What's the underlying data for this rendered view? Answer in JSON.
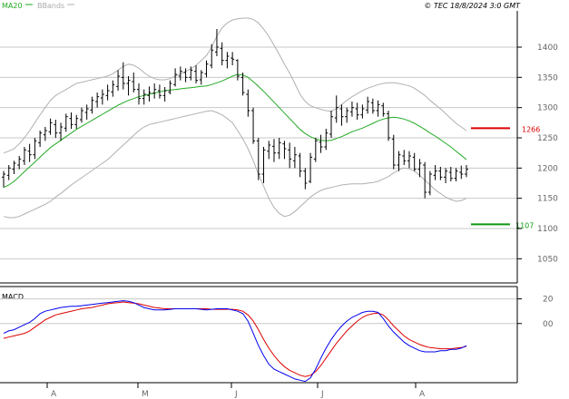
{
  "header": {
    "legend_ma": "MA20",
    "legend_bb": "BBands",
    "copyright": "© TEC 18/8/2024 3:0 GMT"
  },
  "macd_panel": {
    "label": "MACD"
  },
  "colors": {
    "bars": "#000000",
    "ma": "#22aa22",
    "bbands": "#b0b0b0",
    "macd": "#0000ee",
    "signal": "#dd0000",
    "resistance": "#dd0000",
    "support": "#119911",
    "grid": "#c8c8c8"
  },
  "chart_data": [
    {
      "type": "ohlc",
      "title": "",
      "y_ticks": [
        "1400",
        "1350",
        "1300",
        "1250",
        "1200",
        "1150",
        "1100",
        "1050"
      ],
      "x_tick_labels": [
        "A",
        "M",
        "J",
        "J",
        "A"
      ],
      "resistance": {
        "value": 1266,
        "label": "1266"
      },
      "support": {
        "value": 1107,
        "label": "1107"
      },
      "ylim": [
        1010,
        1460
      ],
      "bars": [
        [
          1185,
          1195,
          1168,
          1190
        ],
        [
          1188,
          1205,
          1180,
          1200
        ],
        [
          1198,
          1212,
          1190,
          1208
        ],
        [
          1205,
          1220,
          1198,
          1215
        ],
        [
          1212,
          1235,
          1205,
          1230
        ],
        [
          1228,
          1240,
          1210,
          1222
        ],
        [
          1222,
          1250,
          1215,
          1245
        ],
        [
          1242,
          1262,
          1235,
          1258
        ],
        [
          1255,
          1268,
          1245,
          1262
        ],
        [
          1260,
          1282,
          1255,
          1275
        ],
        [
          1272,
          1280,
          1250,
          1258
        ],
        [
          1258,
          1275,
          1245,
          1268
        ],
        [
          1266,
          1290,
          1260,
          1285
        ],
        [
          1282,
          1292,
          1265,
          1272
        ],
        [
          1272,
          1288,
          1265,
          1282
        ],
        [
          1280,
          1300,
          1275,
          1295
        ],
        [
          1292,
          1305,
          1280,
          1298
        ],
        [
          1296,
          1318,
          1290,
          1312
        ],
        [
          1310,
          1325,
          1300,
          1318
        ],
        [
          1316,
          1330,
          1305,
          1322
        ],
        [
          1320,
          1338,
          1312,
          1328
        ],
        [
          1326,
          1345,
          1318,
          1338
        ],
        [
          1335,
          1362,
          1328,
          1352
        ],
        [
          1350,
          1375,
          1330,
          1340
        ],
        [
          1340,
          1352,
          1320,
          1345
        ],
        [
          1343,
          1358,
          1325,
          1330
        ],
        [
          1330,
          1340,
          1305,
          1315
        ],
        [
          1315,
          1330,
          1305,
          1322
        ],
        [
          1320,
          1335,
          1310,
          1325
        ],
        [
          1324,
          1340,
          1315,
          1330
        ],
        [
          1328,
          1338,
          1315,
          1320
        ],
        [
          1320,
          1334,
          1310,
          1328
        ],
        [
          1326,
          1345,
          1322,
          1340
        ],
        [
          1338,
          1365,
          1335,
          1355
        ],
        [
          1352,
          1368,
          1345,
          1360
        ],
        [
          1358,
          1365,
          1342,
          1350
        ],
        [
          1350,
          1368,
          1345,
          1362
        ],
        [
          1360,
          1370,
          1340,
          1345
        ],
        [
          1346,
          1362,
          1338,
          1358
        ],
        [
          1356,
          1378,
          1350,
          1372
        ],
        [
          1370,
          1405,
          1365,
          1395
        ],
        [
          1392,
          1430,
          1385,
          1400
        ],
        [
          1398,
          1408,
          1370,
          1378
        ],
        [
          1378,
          1392,
          1365,
          1385
        ],
        [
          1382,
          1392,
          1370,
          1380
        ],
        [
          1378,
          1380,
          1345,
          1352
        ],
        [
          1350,
          1358,
          1320,
          1325
        ],
        [
          1322,
          1330,
          1285,
          1295
        ],
        [
          1295,
          1300,
          1240,
          1245
        ],
        [
          1245,
          1250,
          1180,
          1190
        ],
        [
          1190,
          1235,
          1175,
          1230
        ],
        [
          1228,
          1245,
          1215,
          1238
        ],
        [
          1236,
          1248,
          1210,
          1225
        ],
        [
          1225,
          1250,
          1215,
          1242
        ],
        [
          1240,
          1245,
          1215,
          1232
        ],
        [
          1230,
          1242,
          1200,
          1215
        ],
        [
          1212,
          1235,
          1200,
          1222
        ],
        [
          1220,
          1225,
          1185,
          1195
        ],
        [
          1195,
          1200,
          1165,
          1175
        ],
        [
          1178,
          1225,
          1175,
          1218
        ],
        [
          1215,
          1250,
          1210,
          1245
        ],
        [
          1243,
          1255,
          1225,
          1235
        ],
        [
          1235,
          1265,
          1230,
          1258
        ],
        [
          1256,
          1295,
          1250,
          1285
        ],
        [
          1283,
          1320,
          1275,
          1300
        ],
        [
          1298,
          1305,
          1270,
          1285
        ],
        [
          1285,
          1300,
          1275,
          1295
        ],
        [
          1293,
          1310,
          1285,
          1300
        ],
        [
          1298,
          1308,
          1280,
          1288
        ],
        [
          1288,
          1305,
          1282,
          1298
        ],
        [
          1296,
          1318,
          1290,
          1310
        ],
        [
          1308,
          1315,
          1290,
          1295
        ],
        [
          1295,
          1312,
          1285,
          1305
        ],
        [
          1303,
          1308,
          1285,
          1290
        ],
        [
          1290,
          1295,
          1245,
          1250
        ],
        [
          1248,
          1255,
          1198,
          1205
        ],
        [
          1205,
          1228,
          1195,
          1222
        ],
        [
          1220,
          1230,
          1205,
          1212
        ],
        [
          1212,
          1228,
          1200,
          1220
        ],
        [
          1218,
          1225,
          1195,
          1198
        ],
        [
          1198,
          1215,
          1185,
          1208
        ],
        [
          1205,
          1210,
          1150,
          1160
        ],
        [
          1160,
          1195,
          1155,
          1190
        ],
        [
          1188,
          1205,
          1180,
          1195
        ],
        [
          1195,
          1202,
          1180,
          1185
        ],
        [
          1185,
          1200,
          1175,
          1195
        ],
        [
          1193,
          1202,
          1178,
          1183
        ],
        [
          1183,
          1200,
          1178,
          1195
        ],
        [
          1193,
          1204,
          1182,
          1190
        ],
        [
          1190,
          1205,
          1185,
          1198
        ]
      ],
      "ma20": [
        1168,
        1172,
        1178,
        1186,
        1194,
        1202,
        1210,
        1218,
        1226,
        1234,
        1240,
        1246,
        1252,
        1258,
        1264,
        1269,
        1274,
        1279,
        1284,
        1289,
        1294,
        1299,
        1304,
        1308,
        1312,
        1315,
        1318,
        1320,
        1322,
        1324,
        1326,
        1328,
        1329,
        1330,
        1331,
        1332,
        1333,
        1334,
        1335,
        1336,
        1338,
        1341,
        1344,
        1348,
        1352,
        1355,
        1354,
        1350,
        1343,
        1335,
        1327,
        1318,
        1309,
        1300,
        1291,
        1282,
        1273,
        1264,
        1257,
        1252,
        1248,
        1246,
        1245,
        1246,
        1249,
        1252,
        1256,
        1260,
        1263,
        1266,
        1270,
        1274,
        1278,
        1281,
        1283,
        1284,
        1283,
        1281,
        1278,
        1274,
        1269,
        1264,
        1258,
        1253,
        1247,
        1241,
        1235,
        1228,
        1221,
        1214
      ],
      "bb_upper": [
        1225,
        1228,
        1232,
        1240,
        1250,
        1262,
        1275,
        1288,
        1300,
        1312,
        1320,
        1325,
        1330,
        1335,
        1340,
        1342,
        1344,
        1346,
        1348,
        1350,
        1352,
        1356,
        1362,
        1368,
        1372,
        1370,
        1365,
        1358,
        1352,
        1348,
        1346,
        1346,
        1348,
        1352,
        1356,
        1360,
        1364,
        1370,
        1378,
        1386,
        1400,
        1418,
        1432,
        1440,
        1445,
        1447,
        1448,
        1448,
        1446,
        1440,
        1430,
        1418,
        1403,
        1388,
        1372,
        1357,
        1340,
        1322,
        1310,
        1303,
        1300,
        1297,
        1295,
        1294,
        1298,
        1305,
        1312,
        1318,
        1323,
        1328,
        1332,
        1335,
        1338,
        1340,
        1341,
        1341,
        1340,
        1338,
        1336,
        1332,
        1326,
        1320,
        1312,
        1305,
        1298,
        1290,
        1282,
        1274,
        1268,
        1262
      ],
      "bb_lower": [
        1120,
        1118,
        1118,
        1120,
        1124,
        1128,
        1132,
        1136,
        1140,
        1145,
        1152,
        1158,
        1165,
        1172,
        1178,
        1184,
        1190,
        1196,
        1202,
        1208,
        1214,
        1222,
        1230,
        1238,
        1246,
        1254,
        1262,
        1268,
        1272,
        1274,
        1276,
        1278,
        1280,
        1282,
        1284,
        1286,
        1288,
        1290,
        1292,
        1294,
        1295,
        1292,
        1288,
        1282,
        1275,
        1262,
        1248,
        1232,
        1212,
        1190,
        1170,
        1150,
        1135,
        1125,
        1120,
        1122,
        1128,
        1136,
        1144,
        1152,
        1158,
        1163,
        1166,
        1168,
        1170,
        1172,
        1173,
        1174,
        1174,
        1174,
        1175,
        1176,
        1178,
        1182,
        1186,
        1192,
        1197,
        1200,
        1199,
        1195,
        1188,
        1180,
        1172,
        1164,
        1158,
        1152,
        1148,
        1145,
        1146,
        1150
      ]
    },
    {
      "type": "line",
      "title": "MACD",
      "y_ticks": [
        "20",
        "00"
      ],
      "ylim": [
        -48,
        30
      ],
      "series": [
        {
          "name": "",
          "values": [
            -8,
            -6,
            -5,
            -3,
            -1,
            1,
            4,
            8,
            10,
            11,
            12,
            13,
            13.5,
            14,
            14,
            14.5,
            15,
            15.5,
            16,
            16.5,
            17,
            17.5,
            18,
            18.5,
            18,
            17,
            15,
            13,
            12,
            11,
            11,
            11,
            11.5,
            12,
            12,
            12,
            12,
            12,
            11.5,
            11,
            11.5,
            12,
            12,
            12,
            11,
            10,
            8,
            2,
            -8,
            -18,
            -26,
            -33,
            -37,
            -39,
            -41,
            -43,
            -45,
            -46,
            -47,
            -44,
            -37,
            -28,
            -20,
            -13,
            -7,
            -2,
            2,
            5,
            7,
            9,
            10,
            10,
            9,
            4,
            -2,
            -7,
            -11,
            -15,
            -18,
            -20,
            -22,
            -23,
            -23,
            -23,
            -22,
            -22,
            -21,
            -21,
            -20,
            -18
          ]
        },
        {
          "name": "",
          "values": [
            -12,
            -11,
            -10,
            -9,
            -8,
            -6,
            -3,
            0,
            3,
            5,
            7,
            8,
            9,
            10,
            11,
            12,
            12.5,
            13,
            14,
            15,
            16,
            16.5,
            17,
            17.5,
            17,
            16.5,
            16,
            15,
            14,
            13,
            12.5,
            12,
            12,
            12,
            12,
            12,
            12,
            12,
            12,
            12,
            11.5,
            11.5,
            11.5,
            11.5,
            11.5,
            11,
            10,
            7,
            2,
            -5,
            -13,
            -20,
            -26,
            -31,
            -35,
            -38,
            -40,
            -42,
            -43,
            -42,
            -39,
            -34,
            -28,
            -22,
            -16,
            -11,
            -6,
            -2,
            2,
            5,
            7,
            8,
            8.5,
            7,
            3,
            -2,
            -6,
            -10,
            -13,
            -15,
            -17,
            -18.5,
            -19.5,
            -20,
            -20.5,
            -20.5,
            -20.5,
            -20,
            -19.5,
            -18.5
          ]
        }
      ]
    }
  ]
}
